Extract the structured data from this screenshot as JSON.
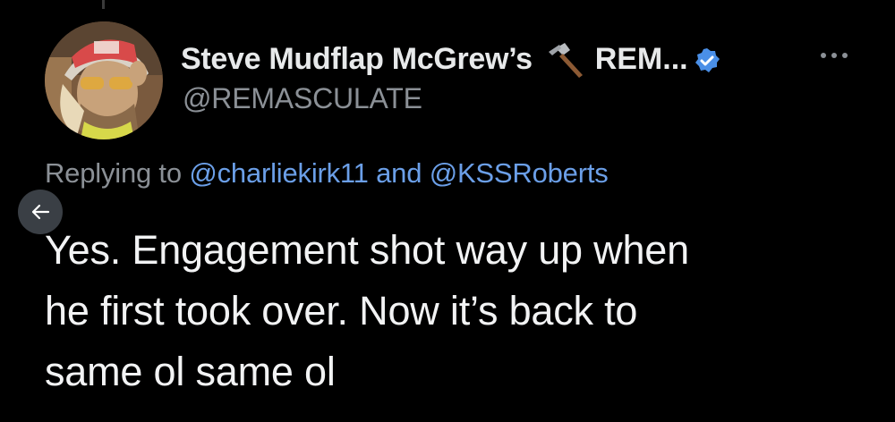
{
  "author": {
    "display_name": "Steve Mudflap McGrew’s",
    "name_emoji": "hammer-icon",
    "name_suffix": "REM...",
    "handle": "@REMASCULATE",
    "verified_icon": "verified-badge-icon"
  },
  "reply_context": {
    "prefix": "Replying to",
    "mention_1": "@charliekirk11",
    "conjunction": "and",
    "mention_2": "@KSSRoberts"
  },
  "tweet": {
    "lines": [
      "Yes.  Engagement shot way up when",
      "he first took over.  Now it’s back to",
      "same ol same ol"
    ]
  },
  "controls": {
    "more_icon": "more-options-icon",
    "back_icon": "back-arrow-icon"
  },
  "colors": {
    "background": "#000000",
    "primary_text": "#e7e9ea",
    "secondary_text": "#8b9096",
    "mention": "#6b9fe8",
    "verified": "#4a8fe7"
  }
}
